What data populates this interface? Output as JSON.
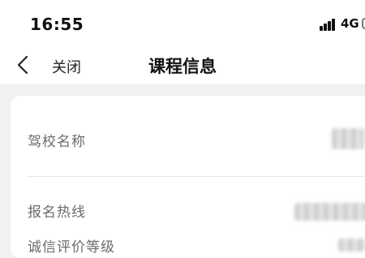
{
  "status_bar": {
    "time": "16:55",
    "network": "4G",
    "icons": [
      "signal-icon",
      "battery-icon"
    ]
  },
  "nav": {
    "close_label": "关闭",
    "title": "课程信息",
    "icons": [
      "chevron-left-icon"
    ]
  },
  "course_info": {
    "rows": [
      {
        "label": "驾校名称"
      },
      {
        "label": "报名热线"
      },
      {
        "label": "诚信评价等级"
      }
    ]
  },
  "colors": {
    "page_background": "#f1f1f1",
    "card_background": "#ffffff",
    "label_text": "#6b6b6b",
    "title_text": "#111111"
  }
}
